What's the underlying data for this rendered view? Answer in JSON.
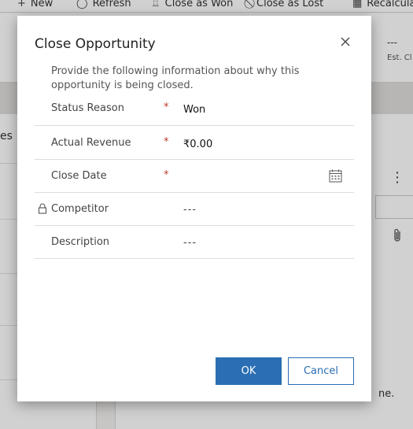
{
  "toolbar": {
    "items": [
      {
        "label": "New",
        "icon": "plus-icon"
      },
      {
        "label": "Refresh",
        "icon": "refresh-icon"
      },
      {
        "label": "Close as Won",
        "icon": "trophy-icon"
      },
      {
        "label": "Close as Lost",
        "icon": "no-entry-icon"
      },
      {
        "label": "Recalcula",
        "icon": "calculator-icon"
      }
    ]
  },
  "background": {
    "header_value": "---",
    "header_label": "Est. Cl",
    "left_fragment": "es",
    "right_fragment": "ne."
  },
  "dialog": {
    "title": "Close Opportunity",
    "description": "Provide the following information about why this opportunity is being closed.",
    "fields": [
      {
        "label": "Status Reason",
        "required": "*",
        "value": "Won"
      },
      {
        "label": "Actual Revenue",
        "required": "*",
        "value": "₹0.00"
      },
      {
        "label": "Close Date",
        "required": "*",
        "value": ""
      },
      {
        "label": "Competitor",
        "required": "",
        "value": "---",
        "locked": true
      },
      {
        "label": "Description",
        "required": "",
        "value": "---"
      }
    ],
    "ok_label": "OK",
    "cancel_label": "Cancel"
  },
  "colors": {
    "accent": "#2b6eb3",
    "required": "#c0392b"
  }
}
